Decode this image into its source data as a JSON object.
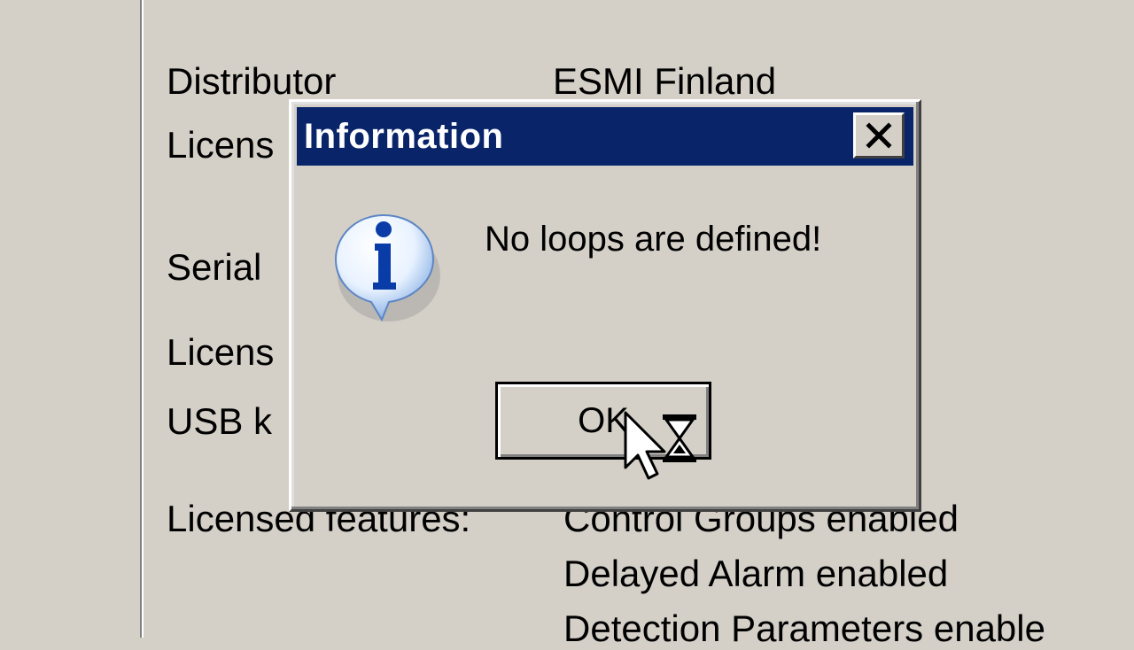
{
  "background": {
    "rows": [
      {
        "label": "Distributor",
        "value": "ESMI Finland"
      },
      {
        "label": "Licens",
        "value": ""
      },
      {
        "label": "Serial",
        "value": ""
      },
      {
        "label": "Licens",
        "value": ""
      },
      {
        "label": "USB k",
        "value": ""
      },
      {
        "label": "Licensed features:",
        "value": "Control Groups enabled"
      }
    ],
    "features_more": [
      "Delayed Alarm enabled",
      "Detection Parameters enable"
    ]
  },
  "dialog": {
    "title": "Information",
    "close_symbol": "✕",
    "message": "No loops are defined!",
    "icon": "information-icon",
    "ok_label": "OK"
  },
  "cursor": {
    "icon": "arrow-busy-cursor-icon"
  },
  "colors": {
    "titlebar": "#0a246a",
    "face": "#d4d0c8"
  }
}
